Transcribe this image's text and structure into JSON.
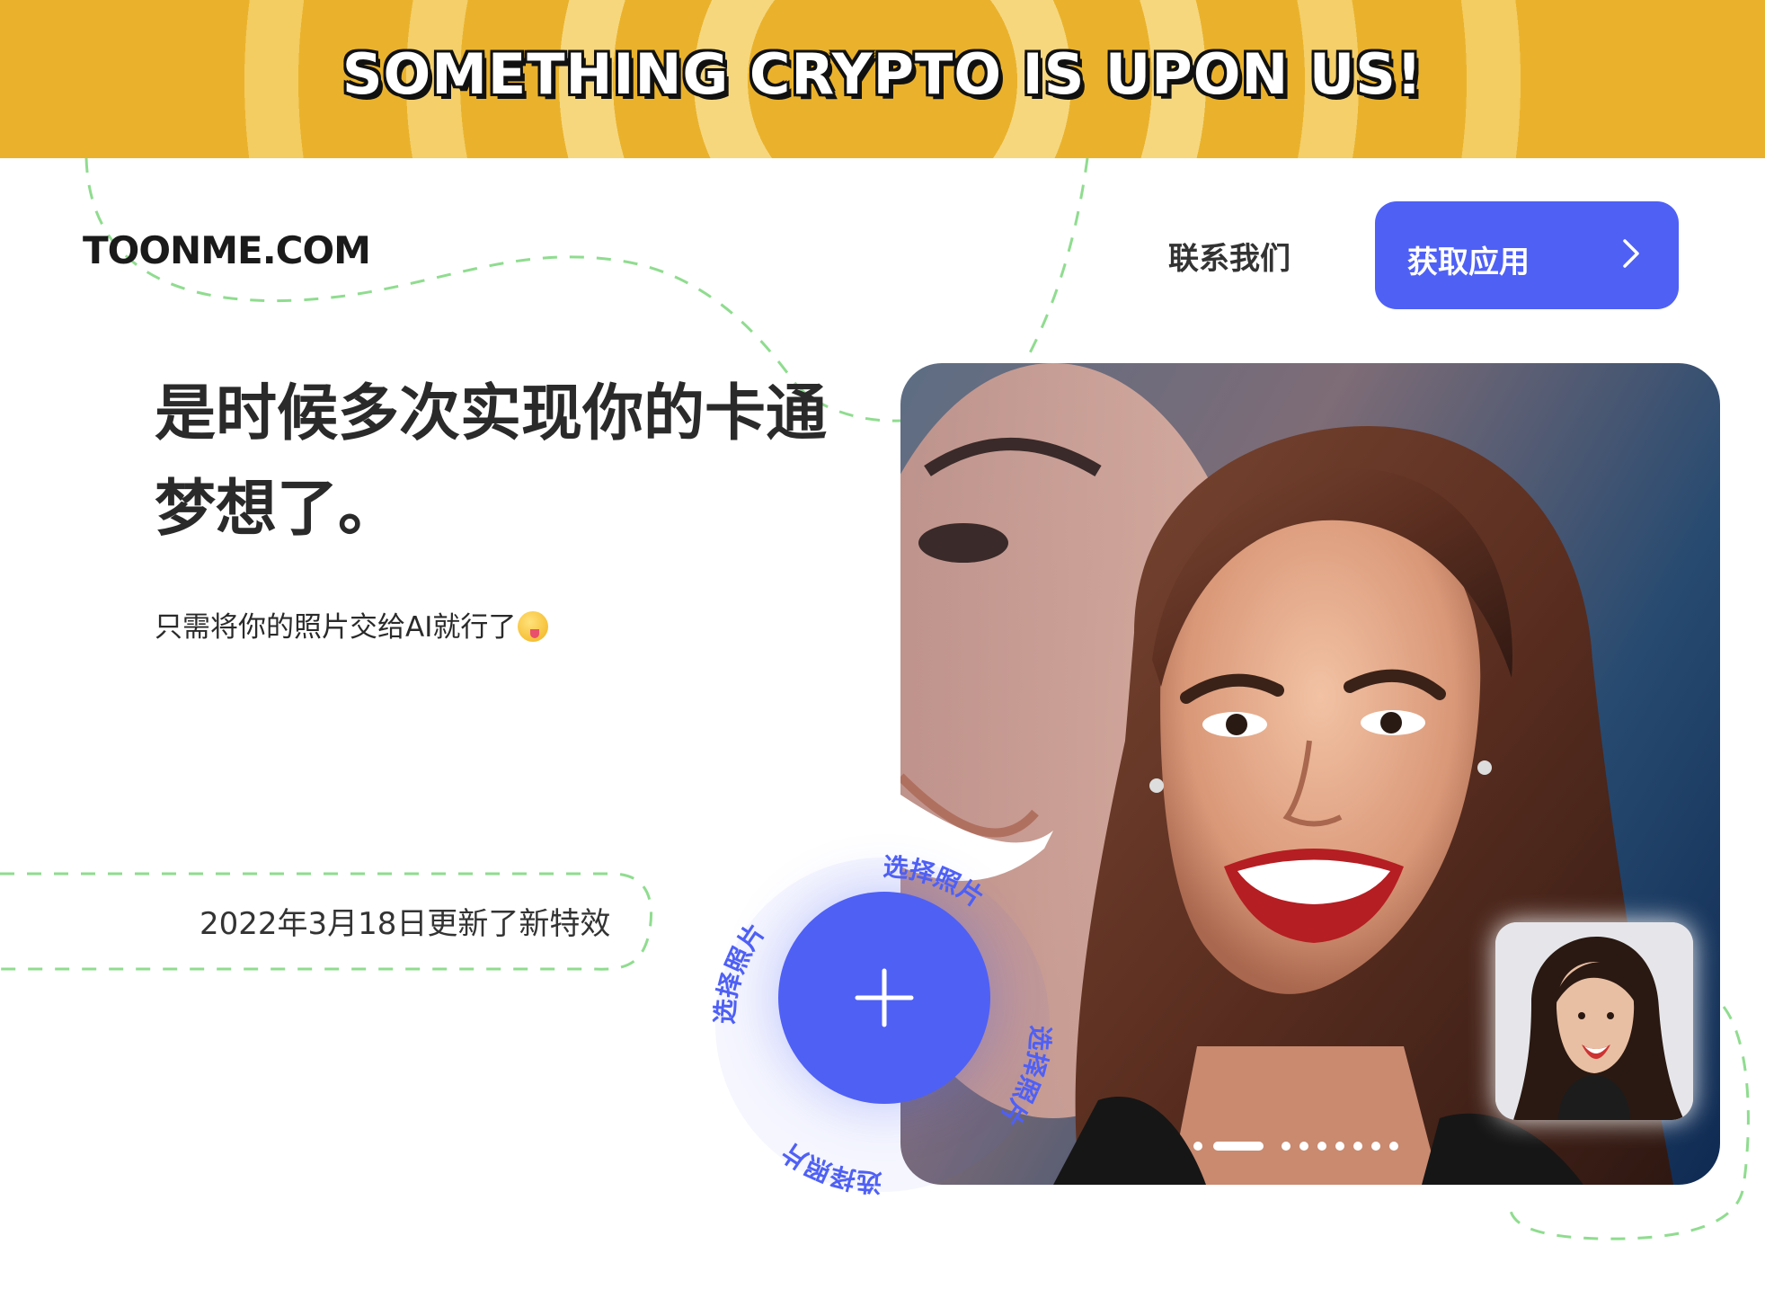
{
  "banner": {
    "text": "SOMETHING CRYPTO IS UPON US!"
  },
  "header": {
    "logo": "TOONME.COM",
    "contact_label": "联系我们",
    "get_app_label": "获取应用"
  },
  "hero": {
    "headline_line1": "是时候多次实现你的卡通",
    "headline_line2": "梦想了。",
    "subline": "只需将你的照片交给AI就行了",
    "update_note": "2022年3月18日更新了新特效"
  },
  "select_photo": {
    "label": "选择照片"
  },
  "carousel": {
    "slide_count": 9,
    "active_index": 1
  },
  "colors": {
    "accent": "#4f60f5",
    "banner": "#eab22c",
    "dashed_line": "#8fdc8f"
  },
  "icons": {
    "chevron": "chevron-right-icon",
    "plus": "plus-icon",
    "emoji": "winking-tongue-emoji-icon"
  }
}
